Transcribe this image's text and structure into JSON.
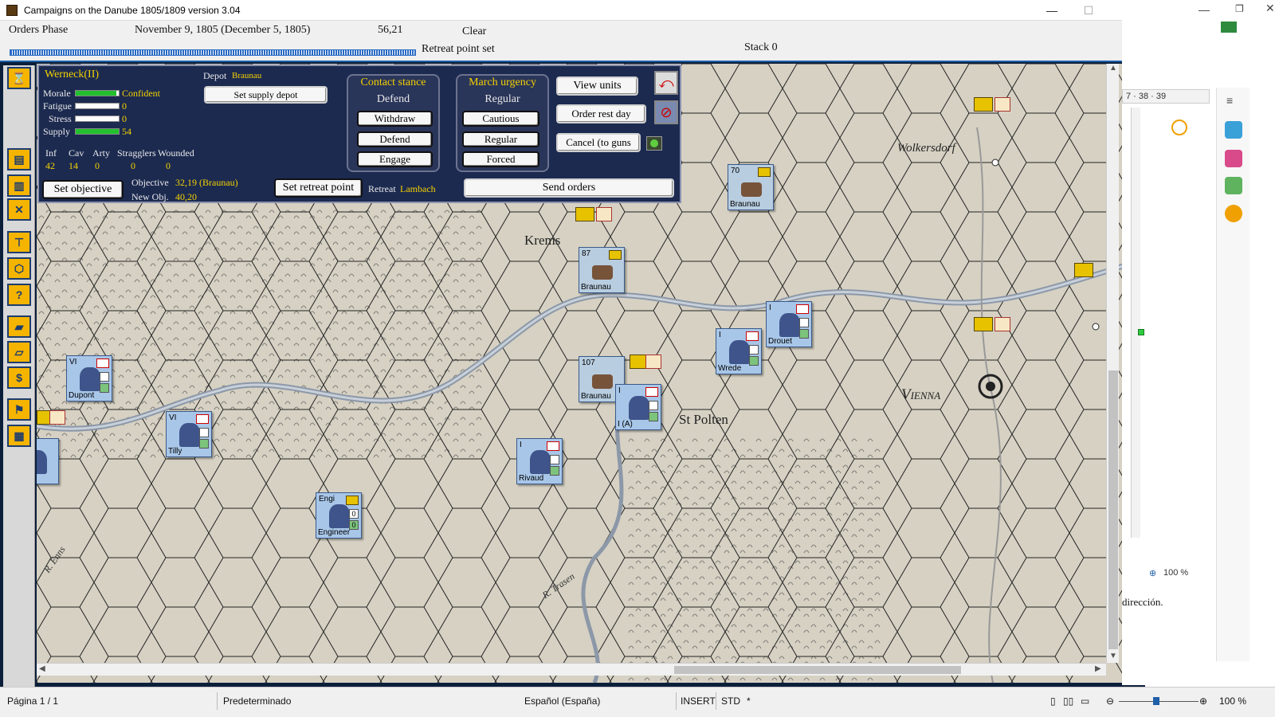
{
  "window": {
    "title": "Campaigns on the Danube 1805/1809  version 3.04",
    "minimize": "—",
    "maximize": "☐",
    "close": "✕"
  },
  "infobar": {
    "phase": "Orders Phase",
    "date": "November 9, 1805 (December 5, 1805)",
    "coords": "56,21",
    "weather": "Clear",
    "message": "Retreat point set",
    "stack": "Stack 0",
    "progress_percent": 100
  },
  "panel": {
    "unit_name": "Werneck(II)",
    "depot_label": "Depot",
    "depot_value": "Braunau",
    "set_supply_depot": "Set supply depot",
    "stats": [
      {
        "label": "Morale",
        "value": "Confident",
        "fill": 0.95
      },
      {
        "label": "Fatigue",
        "value": "0",
        "fill": 0.0
      },
      {
        "label": "Stress",
        "value": "0",
        "fill": 0.0
      },
      {
        "label": "Supply",
        "value": "54",
        "fill": 1.0
      }
    ],
    "strength_headers": [
      "Inf",
      "Cav",
      "Arty",
      "Stragglers",
      "Wounded"
    ],
    "strength_values": [
      "42",
      "14",
      "0",
      "0",
      "0"
    ],
    "set_objective": "Set objective",
    "objective_label": "Objective",
    "objective_value": "32,19 (Braunau)",
    "new_obj_label": "New Obj.",
    "new_obj_value": "40,20",
    "set_retreat_point": "Set retreat point",
    "retreat_label": "Retreat",
    "retreat_value": "Lambach",
    "contact_stance": {
      "title": "Contact stance",
      "current": "Defend",
      "options": [
        "Withdraw",
        "Defend",
        "Engage"
      ]
    },
    "march_urgency": {
      "title": "March urgency",
      "current": "Regular",
      "options": [
        "Cautious",
        "Regular",
        "Forced"
      ]
    },
    "view_units": "View units",
    "order_rest_day": "Order rest day",
    "cancel_to_guns": "Cancel (to guns",
    "send_orders": "Send orders",
    "undo_icon": "curved-arrow-icon",
    "cancel_icon": "no-sign-icon"
  },
  "map": {
    "places": [
      "Krems",
      "St Polten",
      "Vienna",
      "Wolkersdorf"
    ],
    "rivers": [
      "R. Enns",
      "R. Trasen"
    ],
    "counters": [
      {
        "num": "VI",
        "label": "Dupont"
      },
      {
        "num": "VI",
        "label": "Tilly"
      },
      {
        "num": "I",
        "label": "Rivaud"
      },
      {
        "num": "I",
        "label": "Wrede"
      },
      {
        "num": "I",
        "label": "Drouet"
      },
      {
        "num": "I",
        "label": "I (A)"
      },
      {
        "num": "Engi",
        "label": "Engineer",
        "a": "0",
        "b": "0"
      }
    ],
    "supply": [
      {
        "num": "70",
        "label": "Braunau"
      },
      {
        "num": "87",
        "label": "Braunau"
      },
      {
        "num": "107",
        "label": "Braunau"
      }
    ]
  },
  "background_app": {
    "ruler": "7 · 38 · 39",
    "zoom": "100 %",
    "doc_text": "dirección."
  },
  "statusbar": {
    "page": "Página  1 / 1",
    "style": "Predeterminado",
    "language": "Español (España)",
    "insert": "INSERT",
    "std": "STD",
    "star": "*",
    "zoom": "100 %"
  }
}
